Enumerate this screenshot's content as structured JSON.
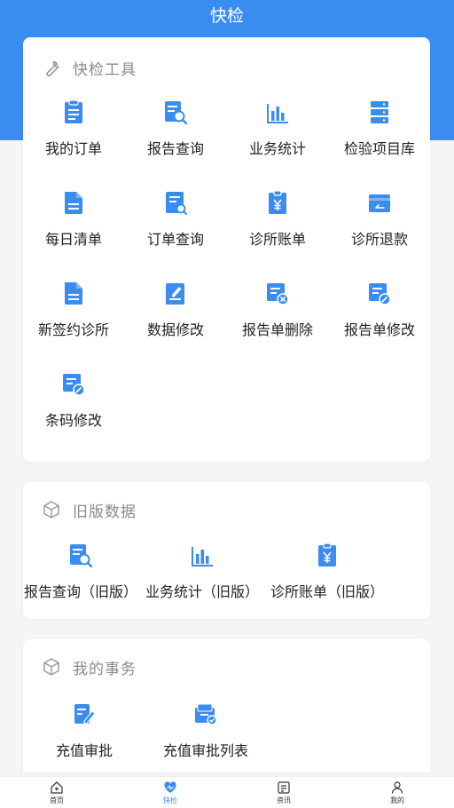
{
  "header": {
    "title": "快检"
  },
  "tools_card": {
    "title": "快检工具",
    "icon": "wrench-icon",
    "items": [
      {
        "label": "我的订单",
        "icon": "clipboard-icon"
      },
      {
        "label": "报告查询",
        "icon": "report-search-icon"
      },
      {
        "label": "业务统计",
        "icon": "bar-chart-icon"
      },
      {
        "label": "检验项目库",
        "icon": "server-stack-icon"
      },
      {
        "label": "每日清单",
        "icon": "document-icon"
      },
      {
        "label": "订单查询",
        "icon": "order-search-icon"
      },
      {
        "label": "诊所账单",
        "icon": "yuan-bill-icon"
      },
      {
        "label": "诊所退款",
        "icon": "refund-card-icon"
      },
      {
        "label": "新签约诊所",
        "icon": "document-icon"
      },
      {
        "label": "数据修改",
        "icon": "edit-document-icon"
      },
      {
        "label": "报告单删除",
        "icon": "report-delete-icon"
      },
      {
        "label": "报告单修改",
        "icon": "report-edit-icon"
      },
      {
        "label": "条码修改",
        "icon": "barcode-edit-icon"
      }
    ]
  },
  "legacy_card": {
    "title": "旧版数据",
    "icon": "cube-icon",
    "items": [
      {
        "label": "报告查询（旧版）",
        "icon": "report-search-icon"
      },
      {
        "label": "业务统计（旧版）",
        "icon": "bar-chart-icon"
      },
      {
        "label": "诊所账单（旧版）",
        "icon": "yuan-bill-icon"
      }
    ]
  },
  "tasks_card": {
    "title": "我的事务",
    "icon": "cube-icon",
    "items": [
      {
        "label": "充值审批",
        "icon": "approve-edit-icon"
      },
      {
        "label": "充值审批列表",
        "icon": "approve-list-icon"
      }
    ]
  },
  "tabbar": {
    "items": [
      {
        "label": "首页",
        "icon": "home-icon",
        "active": false
      },
      {
        "label": "快检",
        "icon": "heart-icon",
        "active": true
      },
      {
        "label": "资讯",
        "icon": "news-icon",
        "active": false
      },
      {
        "label": "我的",
        "icon": "user-icon",
        "active": false
      }
    ]
  },
  "colors": {
    "primary": "#3a8cf0",
    "header_bg": "#3a8cf0",
    "background": "#f4f5f7",
    "card": "#ffffff"
  }
}
